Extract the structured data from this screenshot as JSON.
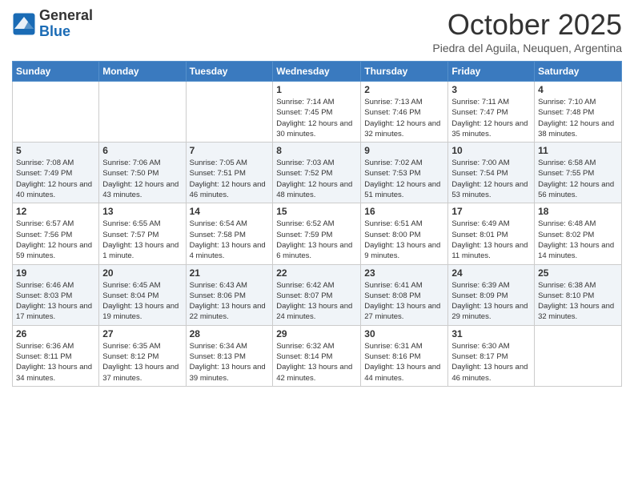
{
  "logo": {
    "general": "General",
    "blue": "Blue"
  },
  "header": {
    "month": "October 2025",
    "location": "Piedra del Aguila, Neuquen, Argentina"
  },
  "weekdays": [
    "Sunday",
    "Monday",
    "Tuesday",
    "Wednesday",
    "Thursday",
    "Friday",
    "Saturday"
  ],
  "weeks": [
    [
      {
        "day": "",
        "sunrise": "",
        "sunset": "",
        "daylight": ""
      },
      {
        "day": "",
        "sunrise": "",
        "sunset": "",
        "daylight": ""
      },
      {
        "day": "",
        "sunrise": "",
        "sunset": "",
        "daylight": ""
      },
      {
        "day": "1",
        "sunrise": "7:14 AM",
        "sunset": "7:45 PM",
        "daylight": "12 hours and 30 minutes."
      },
      {
        "day": "2",
        "sunrise": "7:13 AM",
        "sunset": "7:46 PM",
        "daylight": "12 hours and 32 minutes."
      },
      {
        "day": "3",
        "sunrise": "7:11 AM",
        "sunset": "7:47 PM",
        "daylight": "12 hours and 35 minutes."
      },
      {
        "day": "4",
        "sunrise": "7:10 AM",
        "sunset": "7:48 PM",
        "daylight": "12 hours and 38 minutes."
      }
    ],
    [
      {
        "day": "5",
        "sunrise": "7:08 AM",
        "sunset": "7:49 PM",
        "daylight": "12 hours and 40 minutes."
      },
      {
        "day": "6",
        "sunrise": "7:06 AM",
        "sunset": "7:50 PM",
        "daylight": "12 hours and 43 minutes."
      },
      {
        "day": "7",
        "sunrise": "7:05 AM",
        "sunset": "7:51 PM",
        "daylight": "12 hours and 46 minutes."
      },
      {
        "day": "8",
        "sunrise": "7:03 AM",
        "sunset": "7:52 PM",
        "daylight": "12 hours and 48 minutes."
      },
      {
        "day": "9",
        "sunrise": "7:02 AM",
        "sunset": "7:53 PM",
        "daylight": "12 hours and 51 minutes."
      },
      {
        "day": "10",
        "sunrise": "7:00 AM",
        "sunset": "7:54 PM",
        "daylight": "12 hours and 53 minutes."
      },
      {
        "day": "11",
        "sunrise": "6:58 AM",
        "sunset": "7:55 PM",
        "daylight": "12 hours and 56 minutes."
      }
    ],
    [
      {
        "day": "12",
        "sunrise": "6:57 AM",
        "sunset": "7:56 PM",
        "daylight": "12 hours and 59 minutes."
      },
      {
        "day": "13",
        "sunrise": "6:55 AM",
        "sunset": "7:57 PM",
        "daylight": "13 hours and 1 minute."
      },
      {
        "day": "14",
        "sunrise": "6:54 AM",
        "sunset": "7:58 PM",
        "daylight": "13 hours and 4 minutes."
      },
      {
        "day": "15",
        "sunrise": "6:52 AM",
        "sunset": "7:59 PM",
        "daylight": "13 hours and 6 minutes."
      },
      {
        "day": "16",
        "sunrise": "6:51 AM",
        "sunset": "8:00 PM",
        "daylight": "13 hours and 9 minutes."
      },
      {
        "day": "17",
        "sunrise": "6:49 AM",
        "sunset": "8:01 PM",
        "daylight": "13 hours and 11 minutes."
      },
      {
        "day": "18",
        "sunrise": "6:48 AM",
        "sunset": "8:02 PM",
        "daylight": "13 hours and 14 minutes."
      }
    ],
    [
      {
        "day": "19",
        "sunrise": "6:46 AM",
        "sunset": "8:03 PM",
        "daylight": "13 hours and 17 minutes."
      },
      {
        "day": "20",
        "sunrise": "6:45 AM",
        "sunset": "8:04 PM",
        "daylight": "13 hours and 19 minutes."
      },
      {
        "day": "21",
        "sunrise": "6:43 AM",
        "sunset": "8:06 PM",
        "daylight": "13 hours and 22 minutes."
      },
      {
        "day": "22",
        "sunrise": "6:42 AM",
        "sunset": "8:07 PM",
        "daylight": "13 hours and 24 minutes."
      },
      {
        "day": "23",
        "sunrise": "6:41 AM",
        "sunset": "8:08 PM",
        "daylight": "13 hours and 27 minutes."
      },
      {
        "day": "24",
        "sunrise": "6:39 AM",
        "sunset": "8:09 PM",
        "daylight": "13 hours and 29 minutes."
      },
      {
        "day": "25",
        "sunrise": "6:38 AM",
        "sunset": "8:10 PM",
        "daylight": "13 hours and 32 minutes."
      }
    ],
    [
      {
        "day": "26",
        "sunrise": "6:36 AM",
        "sunset": "8:11 PM",
        "daylight": "13 hours and 34 minutes."
      },
      {
        "day": "27",
        "sunrise": "6:35 AM",
        "sunset": "8:12 PM",
        "daylight": "13 hours and 37 minutes."
      },
      {
        "day": "28",
        "sunrise": "6:34 AM",
        "sunset": "8:13 PM",
        "daylight": "13 hours and 39 minutes."
      },
      {
        "day": "29",
        "sunrise": "6:32 AM",
        "sunset": "8:14 PM",
        "daylight": "13 hours and 42 minutes."
      },
      {
        "day": "30",
        "sunrise": "6:31 AM",
        "sunset": "8:16 PM",
        "daylight": "13 hours and 44 minutes."
      },
      {
        "day": "31",
        "sunrise": "6:30 AM",
        "sunset": "8:17 PM",
        "daylight": "13 hours and 46 minutes."
      },
      {
        "day": "",
        "sunrise": "",
        "sunset": "",
        "daylight": ""
      }
    ]
  ],
  "labels": {
    "sunrise": "Sunrise:",
    "sunset": "Sunset:",
    "daylight": "Daylight:"
  }
}
